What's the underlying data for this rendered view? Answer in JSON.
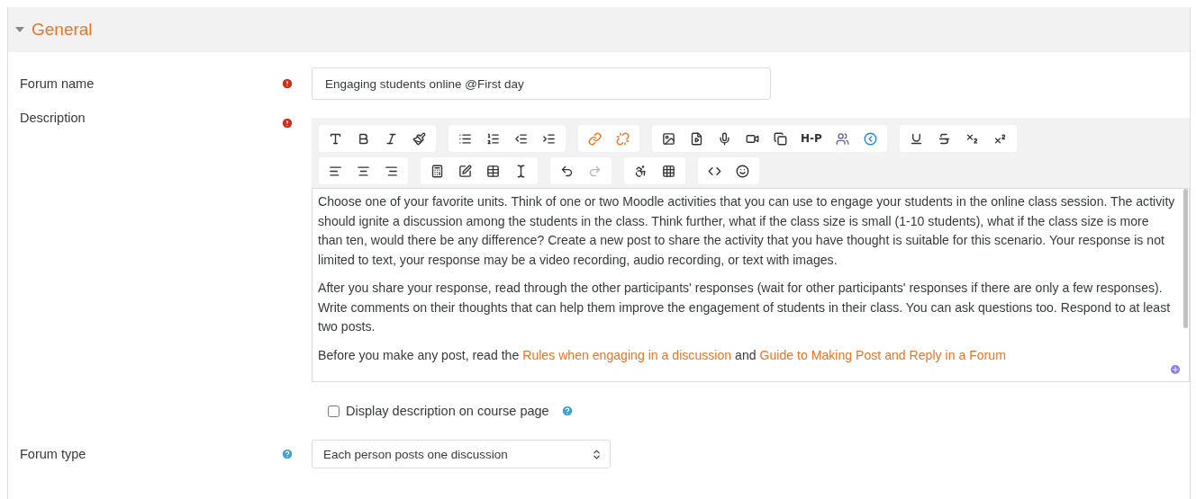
{
  "section": {
    "title": "General",
    "expanded": true
  },
  "forum_name": {
    "label": "Forum name",
    "required": true,
    "value": "Engaging students online @First day"
  },
  "description": {
    "label": "Description",
    "required": true,
    "toolbar": [
      [
        {
          "buttons": [
            {
              "disabled": false
            },
            {
              "disabled": false
            },
            {
              "disabled": false
            },
            {
              "disabled": false
            }
          ]
        },
        {
          "buttons": [
            {
              "disabled": false
            },
            {
              "disabled": false
            },
            {
              "disabled": false
            },
            {
              "disabled": false
            }
          ]
        },
        {
          "buttons": [
            {
              "disabled": false
            },
            {
              "disabled": false
            }
          ]
        },
        {
          "buttons": [
            {
              "disabled": false
            },
            {
              "disabled": false
            },
            {
              "disabled": false
            },
            {
              "disabled": false
            },
            {
              "disabled": false
            },
            {
              "disabled": false,
              "label": "H-P"
            },
            {
              "disabled": false
            },
            {
              "disabled": false
            }
          ]
        },
        {
          "buttons": [
            {
              "disabled": false
            },
            {
              "disabled": false
            },
            {
              "disabled": false
            },
            {
              "disabled": false
            }
          ]
        }
      ],
      [
        {
          "buttons": [
            {
              "disabled": false
            },
            {
              "disabled": false
            },
            {
              "disabled": false
            }
          ]
        },
        {
          "buttons": [
            {
              "disabled": false
            },
            {
              "disabled": false
            },
            {
              "disabled": false
            },
            {
              "disabled": false
            }
          ]
        },
        {
          "buttons": [
            {
              "disabled": false
            },
            {
              "disabled": true
            }
          ]
        },
        {
          "buttons": [
            {
              "disabled": false
            },
            {
              "disabled": false
            }
          ]
        },
        {
          "buttons": [
            {
              "disabled": false
            },
            {
              "disabled": false
            }
          ]
        }
      ]
    ],
    "paragraphs": [
      {
        "parts": [
          {
            "kind": "text",
            "text": "Choose one of your favorite units. Think of one or two Moodle activities that you can use to engage your students in the online class session. The activity should ignite a discussion among the students in the class. Think further, what if the class size is small (1-10 students), what if the class size is more than ten, would there be any difference?  Create a new post to share the activity that you have thought is suitable for this scenario. Your response is not limited to text, your response may be a video recording, audio recording, or text with images."
          }
        ]
      },
      {
        "parts": [
          {
            "kind": "text",
            "text": "After you share your response, read through the other participants' responses (wait for other participants' responses if there are only a few responses). Write comments on their thoughts that can help them improve the engagement of students in their class. You can ask questions too. Respond to at least two posts."
          }
        ]
      },
      {
        "parts": [
          {
            "kind": "text",
            "text": "Before you make any post, read the "
          },
          {
            "kind": "link",
            "text": "Rules when engaging in a discussion"
          },
          {
            "kind": "text",
            "text": " and "
          },
          {
            "kind": "link",
            "text": "Guide to Making Post and Reply in a Forum"
          }
        ]
      }
    ]
  },
  "display_on_course_page": {
    "label": "Display description on course page",
    "checked": false,
    "help": true
  },
  "forum_type": {
    "label": "Forum type",
    "help": true,
    "value": "Each person posts one discussion"
  }
}
